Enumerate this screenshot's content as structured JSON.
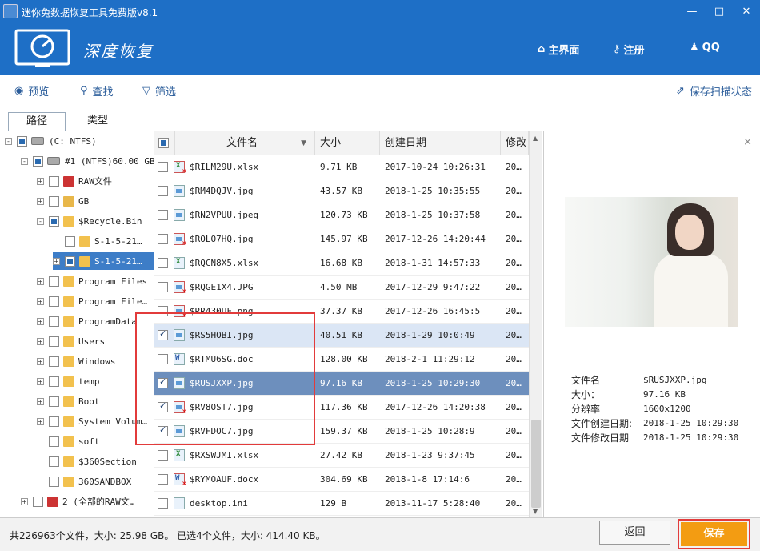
{
  "window": {
    "title": "迷你兔数据恢复工具免费版v8.1",
    "min": "—",
    "max": "□",
    "close": "✕"
  },
  "banner": {
    "brand": "深度恢复",
    "nav": [
      "主界面",
      "注册",
      "QQ"
    ]
  },
  "toolbar": {
    "preview": "预览",
    "find": "查找",
    "filter": "筛选",
    "save_scan": "保存扫描状态"
  },
  "tabs": {
    "path": "路径",
    "type": "类型"
  },
  "tree": [
    {
      "label": "(C: NTFS)",
      "exp": "-",
      "cb": "part",
      "icon": "drive"
    },
    {
      "label": "#1 (NTFS)60.00 GB",
      "exp": "-",
      "cb": "part",
      "icon": "drive"
    },
    {
      "label": "RAW文件",
      "exp": "+",
      "cb": "",
      "icon": "warn"
    },
    {
      "label": "GB",
      "exp": "+",
      "cb": "",
      "icon": "unknown"
    },
    {
      "label": "$Recycle.Bin",
      "exp": "-",
      "cb": "part",
      "icon": "folder"
    },
    {
      "label": "S-1-5-21…",
      "exp": "",
      "cb": "",
      "icon": "folder"
    },
    {
      "label": "S-1-5-21…",
      "exp": "+",
      "cb": "part",
      "icon": "folder",
      "selected": true
    },
    {
      "label": "Program Files",
      "exp": "+",
      "cb": "",
      "icon": "folder"
    },
    {
      "label": "Program File…",
      "exp": "+",
      "cb": "",
      "icon": "folder"
    },
    {
      "label": "ProgramData",
      "exp": "+",
      "cb": "",
      "icon": "folder"
    },
    {
      "label": "Users",
      "exp": "+",
      "cb": "",
      "icon": "folder"
    },
    {
      "label": "Windows",
      "exp": "+",
      "cb": "",
      "icon": "folder"
    },
    {
      "label": "temp",
      "exp": "+",
      "cb": "",
      "icon": "folder"
    },
    {
      "label": "Boot",
      "exp": "+",
      "cb": "",
      "icon": "folder"
    },
    {
      "label": "System Volum…",
      "exp": "+",
      "cb": "",
      "icon": "folder"
    },
    {
      "label": "soft",
      "exp": "",
      "cb": "",
      "icon": "folder"
    },
    {
      "label": "$360Section",
      "exp": "",
      "cb": "",
      "icon": "folder"
    },
    {
      "label": "360SANDBOX",
      "exp": "",
      "cb": "",
      "icon": "folder"
    },
    {
      "label": "2 (全部的RAW文…",
      "exp": "+",
      "cb": "",
      "icon": "warn"
    }
  ],
  "columns": {
    "name": "文件名",
    "size": "大小",
    "created": "创建日期",
    "modified": "修改日"
  },
  "files": [
    {
      "name": "$RILM29U.xlsx",
      "size": "9.71 KB",
      "created": "2017-10-24 10:26:31",
      "mod": "20…",
      "type": "xls",
      "bad": true,
      "checked": false
    },
    {
      "name": "$RM4DQJV.jpg",
      "size": "43.57 KB",
      "created": "2018-1-25 10:35:55",
      "mod": "20…",
      "type": "img",
      "bad": false,
      "checked": false
    },
    {
      "name": "$RN2VPUU.jpeg",
      "size": "120.73 KB",
      "created": "2018-1-25 10:37:58",
      "mod": "20…",
      "type": "img",
      "bad": false,
      "checked": false
    },
    {
      "name": "$ROLO7HQ.jpg",
      "size": "145.97 KB",
      "created": "2017-12-26 14:20:44",
      "mod": "20…",
      "type": "img",
      "bad": true,
      "checked": false
    },
    {
      "name": "$RQCN8X5.xlsx",
      "size": "16.68 KB",
      "created": "2018-1-31 14:57:33",
      "mod": "20…",
      "type": "xls",
      "bad": false,
      "checked": false
    },
    {
      "name": "$RQGE1X4.JPG",
      "size": "4.50 MB",
      "created": "2017-12-29 9:47:22",
      "mod": "20…",
      "type": "img",
      "bad": true,
      "checked": false
    },
    {
      "name": "$RR430UF.png",
      "size": "37.37 KB",
      "created": "2017-12-26 16:45:5",
      "mod": "20…",
      "type": "img",
      "bad": true,
      "checked": false
    },
    {
      "name": "$RS5HOBI.jpg",
      "size": "40.51 KB",
      "created": "2018-1-29 10:0:49",
      "mod": "20…",
      "type": "img",
      "bad": false,
      "checked": true,
      "hl": true
    },
    {
      "name": "$RTMU6SG.doc",
      "size": "128.00 KB",
      "created": "2018-2-1 11:29:12",
      "mod": "20…",
      "type": "doc",
      "bad": false,
      "checked": false
    },
    {
      "name": "$RUSJXXP.jpg",
      "size": "97.16 KB",
      "created": "2018-1-25 10:29:30",
      "mod": "20…",
      "type": "img",
      "bad": false,
      "checked": true,
      "selected": true
    },
    {
      "name": "$RV8OST7.jpg",
      "size": "117.36 KB",
      "created": "2017-12-26 14:20:38",
      "mod": "20…",
      "type": "img",
      "bad": true,
      "checked": true
    },
    {
      "name": "$RVFDOC7.jpg",
      "size": "159.37 KB",
      "created": "2018-1-25 10:28:9",
      "mod": "20…",
      "type": "img",
      "bad": false,
      "checked": true
    },
    {
      "name": "$RXSWJMI.xlsx",
      "size": "27.42 KB",
      "created": "2018-1-23 9:37:45",
      "mod": "20…",
      "type": "xls",
      "bad": false,
      "checked": false
    },
    {
      "name": "$RYMOAUF.docx",
      "size": "304.69 KB",
      "created": "2018-1-8 17:14:6",
      "mod": "20…",
      "type": "doc",
      "bad": true,
      "checked": false
    },
    {
      "name": "desktop.ini",
      "size": "129 B",
      "created": "2013-11-17 5:28:40",
      "mod": "20…",
      "type": "ini",
      "bad": false,
      "checked": false
    }
  ],
  "preview": {
    "close": "×",
    "labels": [
      "文件名",
      "大小：",
      "分辨率",
      "文件创建日期:",
      "文件修改日期"
    ],
    "values": [
      "$RUSJXXP.jpg",
      "97.16 KB",
      "1600x1200",
      "2018-1-25 10:29:30",
      "2018-1-25 10:29:30"
    ]
  },
  "status": {
    "text": "共226963个文件，大小: 25.98 GB。 已选4个文件，大小: 414.40 KB。",
    "back": "返回",
    "save": "保存"
  }
}
